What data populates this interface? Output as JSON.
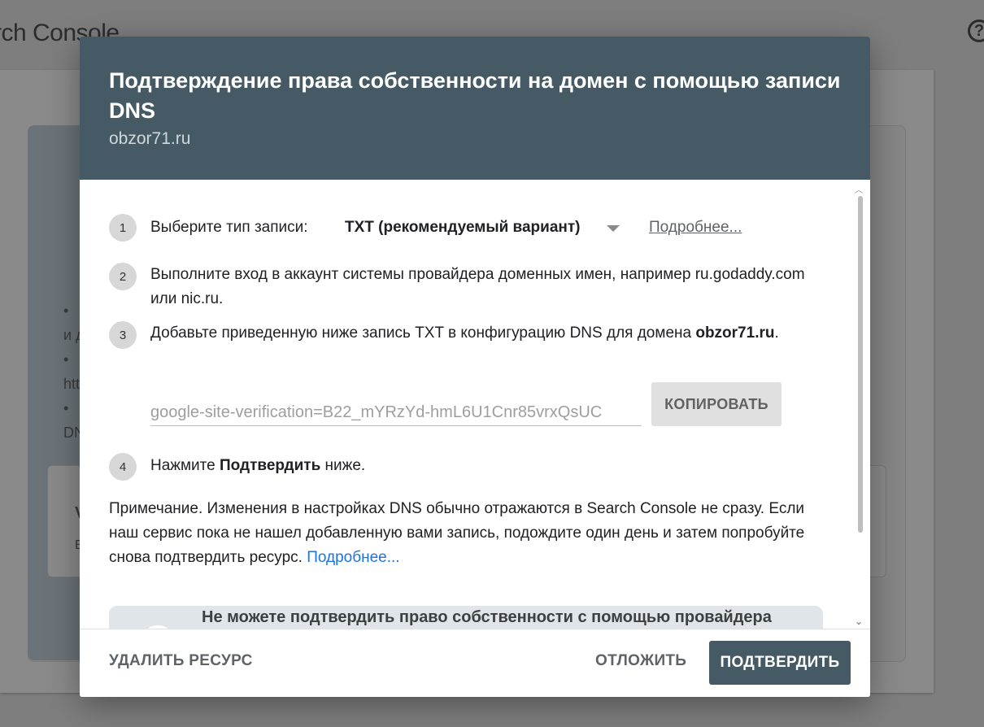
{
  "background": {
    "app_title": "rch Console",
    "help_icon": "?",
    "fragments": [
      "•",
      "и д",
      "•",
      "htt",
      "•",
      "DN",
      "V",
      "E"
    ]
  },
  "dialog": {
    "title": "Подтверждение права собственности на домен с помощью записи DNS",
    "subtitle": "obzor71.ru",
    "steps": [
      {
        "num": "1",
        "text": "Выберите тип записи:",
        "record_type": "TXT (рекомендуемый вариант)",
        "more_link": "Подробнее..."
      },
      {
        "num": "2",
        "text": "Выполните вход в аккаунт системы провайдера доменных имен, например ru.godaddy.com или nic.ru."
      },
      {
        "num": "3",
        "text_before": "Добавьте приведенную ниже запись TXT в конфигурацию DNS для домена ",
        "domain": "obzor71.ru",
        "text_after": ".",
        "txt_value": "google-site-verification=B22_mYRzYd-hmL6U1Cnr85vrxQsUC",
        "copy_label": "КОПИРОВАТЬ"
      },
      {
        "num": "4",
        "text_before": "Нажмите ",
        "bold": "Подтвердить",
        "text_after": " ниже."
      }
    ],
    "note": "Примечание. Изменения в настройках DNS обычно отражаются в Search Console не сразу. Если наш сервис пока не нашел добавленную вами запись, подождите один день и затем попробуйте снова подтвердить ресурс.",
    "note_link": "Подробнее...",
    "alt_box_text": "Не можете подтвердить право собственности с помощью провайдера",
    "footer": {
      "delete_label": "УДАЛИТЬ РЕСУРС",
      "later_label": "ОТЛОЖИТЬ",
      "confirm_label": "ПОДТВЕРДИТЬ"
    }
  },
  "colors": {
    "header_bg": "#455a64",
    "primary_button": "#455a64",
    "link": "#1a73e8"
  }
}
